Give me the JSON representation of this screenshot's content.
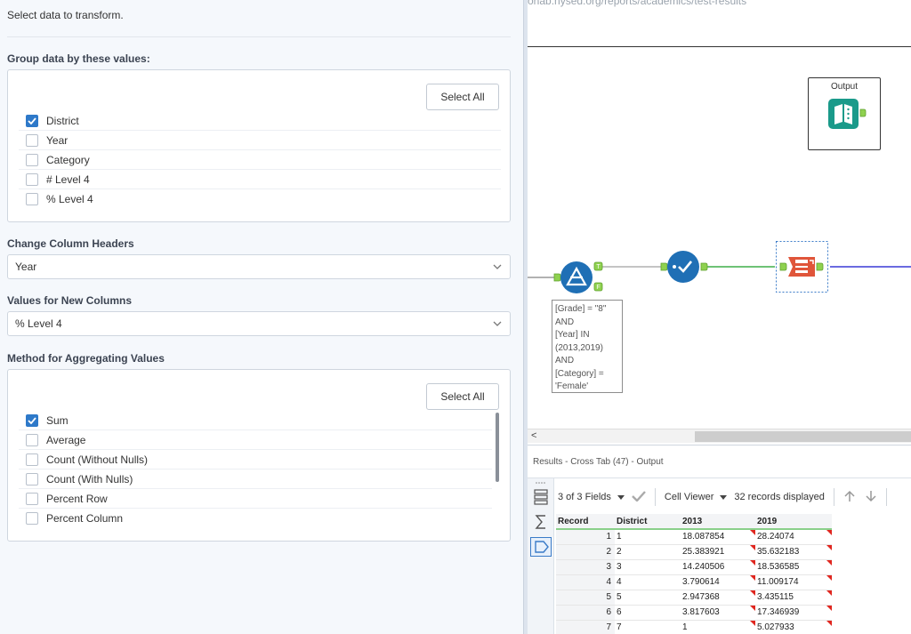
{
  "left_panel": {
    "intro": "Select data to transform.",
    "group": {
      "label": "Group data by these values:",
      "select_all": "Select All",
      "items": [
        {
          "label": "District",
          "checked": true
        },
        {
          "label": "Year",
          "checked": false
        },
        {
          "label": "Category",
          "checked": false
        },
        {
          "label": "# Level 4",
          "checked": false
        },
        {
          "label": "% Level 4",
          "checked": false
        }
      ]
    },
    "headers": {
      "label": "Change Column Headers",
      "value": "Year"
    },
    "values": {
      "label": "Values for New Columns",
      "value": "% Level 4"
    },
    "method": {
      "label": "Method for Aggregating Values",
      "select_all": "Select All",
      "items": [
        {
          "label": "Sum",
          "checked": true
        },
        {
          "label": "Average",
          "checked": false
        },
        {
          "label": "Count (Without Nulls)",
          "checked": false
        },
        {
          "label": "Count (With Nulls)",
          "checked": false
        },
        {
          "label": "Percent Row",
          "checked": false
        },
        {
          "label": "Percent Column",
          "checked": false
        }
      ]
    }
  },
  "canvas": {
    "url_text": "onab.nysed.org/reports/academics/test-results",
    "output_label": "Output",
    "filter_lines": [
      "[Grade] = \"8\"",
      "AND",
      "[Year] IN",
      "(2013,2019)",
      "AND",
      "[Category] =",
      "'Female'"
    ],
    "scroll_arrow": "<",
    "colors": {
      "green_line": "#3fae49",
      "blue_line": "#3a3ad6",
      "teal": "#1a9a8a",
      "crosstab": "#e0553a",
      "filter": "#1f6fb5"
    }
  },
  "results": {
    "title": "Results - Cross Tab (47) - Output",
    "fields": "3 of 3 Fields",
    "viewer": "Cell Viewer",
    "records": "32 records displayed",
    "columns": [
      "Record",
      "District",
      "2013",
      "2019"
    ],
    "rows": [
      [
        "1",
        "1",
        "18.087854",
        "28.24074"
      ],
      [
        "2",
        "2",
        "25.383921",
        "35.632183"
      ],
      [
        "3",
        "3",
        "14.240506",
        "18.536585"
      ],
      [
        "4",
        "4",
        "3.790614",
        "11.009174"
      ],
      [
        "5",
        "5",
        "2.947368",
        "3.435115"
      ],
      [
        "6",
        "6",
        "3.817603",
        "17.346939"
      ],
      [
        "7",
        "7",
        "1",
        "5.027933"
      ]
    ]
  }
}
